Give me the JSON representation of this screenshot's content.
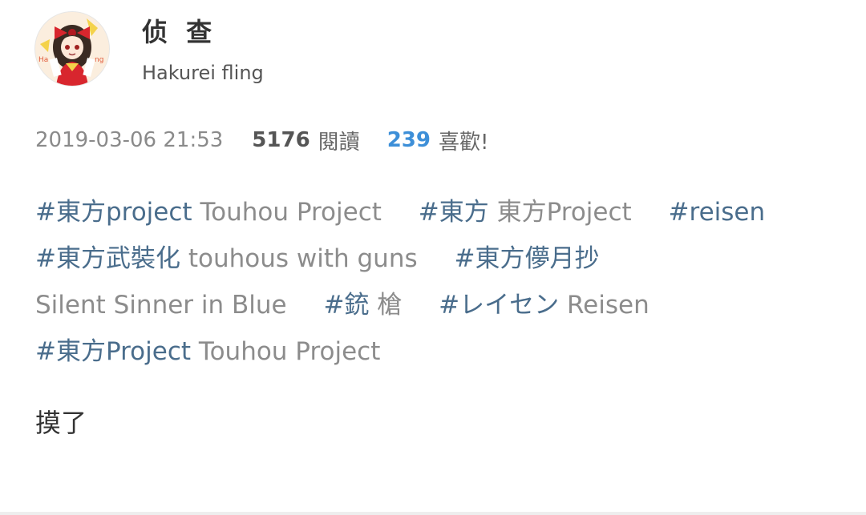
{
  "author": {
    "name": "侦 查",
    "subtitle": "Hakurei fling",
    "avatar_icon": "reimu-avatar-icon"
  },
  "meta": {
    "date": "2019-03-06 21:53",
    "reads_count": "5176",
    "reads_label": "閱讀",
    "likes_count": "239",
    "likes_label": "喜歡!"
  },
  "tags": [
    [
      {
        "tag": "#東方project",
        "desc": "Touhou Project"
      },
      {
        "tag": "#東方",
        "desc": "東方Project"
      },
      {
        "tag": "#reisen",
        "desc": ""
      }
    ],
    [
      {
        "tag": "#東方武裝化",
        "desc": "touhous with guns"
      },
      {
        "tag": "#東方儚月抄",
        "desc": ""
      }
    ],
    [
      {
        "tag": "",
        "desc": "Silent Sinner in Blue"
      },
      {
        "tag": "#銃",
        "desc": "槍"
      },
      {
        "tag": "#レイセン",
        "desc": "Reisen"
      }
    ],
    [
      {
        "tag": "#東方Project",
        "desc": "Touhou Project"
      }
    ]
  ],
  "body": {
    "text": "摸了"
  },
  "colors": {
    "tag": "#4a6d8c",
    "likes": "#3d8fd8",
    "muted": "#8c8c8c"
  }
}
